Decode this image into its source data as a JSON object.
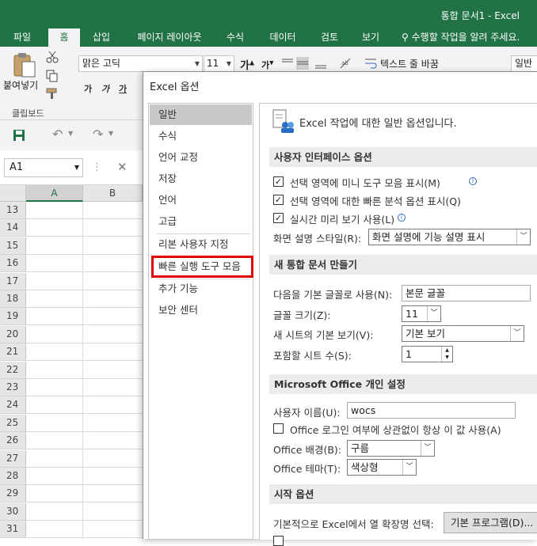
{
  "window": {
    "title": "통합 문서1 - Excel"
  },
  "ribbon": {
    "tabs": [
      "파일",
      "홈",
      "삽입",
      "페이지 레이아웃",
      "수식",
      "데이터",
      "검토",
      "보기"
    ],
    "active_tab": "홈",
    "tell_me": "수행할 작업을 알려 주세요.",
    "paste_label": "붙여넣기",
    "clipboard_group": "클립보드",
    "font_name": "맑은 고딕",
    "font_size": "11",
    "bold": "가",
    "italic": "가",
    "underline": "가",
    "wrap_text": "텍스트 줄 바꿈",
    "number_format": "일반"
  },
  "formula_bar": {
    "name_box": "A1",
    "dots": "⋮",
    "cancel": "✕"
  },
  "sheet": {
    "columns": [
      "A",
      "B"
    ],
    "rows": [
      "13",
      "14",
      "15",
      "16",
      "17",
      "18",
      "19",
      "20",
      "21",
      "22",
      "23",
      "24",
      "25",
      "26",
      "27",
      "28",
      "29",
      "30",
      "31"
    ]
  },
  "dialog": {
    "title": "Excel 옵션",
    "nav": [
      "일반",
      "수식",
      "언어 교정",
      "저장",
      "언어",
      "고급",
      "리본 사용자 지정",
      "빠른 실행 도구 모음",
      "추가 기능",
      "보안 센터"
    ],
    "active_nav": "일반",
    "highlighted_nav": "빠른 실행 도구 모음",
    "intro": "Excel 작업에 대한 일반 옵션입니다.",
    "ui_section": {
      "header": "사용자 인터페이스 옵션",
      "mini_toolbar": "선택 영역에 미니 도구 모음 표시(M)",
      "quick_analysis": "선택 영역에 대한 빠른 분석 옵션 표시(Q)",
      "live_preview": "실시간 미리 보기 사용(L)",
      "screentip_label": "화면 설명 스타일(R):",
      "screentip_value": "화면 설명에 기능 설명 표시"
    },
    "new_wb_section": {
      "header": "새 통합 문서 만들기",
      "font_label": "다음을 기본 글꼴로 사용(N):",
      "font_value": "본문 글꼴",
      "size_label": "글꼴 크기(Z):",
      "size_value": "11",
      "view_label": "새 시트의 기본 보기(V):",
      "view_value": "기본 보기",
      "sheets_label": "포함할 시트 수(S):",
      "sheets_value": "1"
    },
    "personal_section": {
      "header": "Microsoft Office 개인 설정",
      "username_label": "사용자 이름(U):",
      "username_value": "wocs",
      "always_use": "Office 로그인 여부에 상관없이 항상 이 값 사용(A)",
      "background_label": "Office 배경(B):",
      "background_value": "구름",
      "theme_label": "Office 테마(T):",
      "theme_value": "색상형"
    },
    "startup_section": {
      "header": "시작 옵션",
      "ext_label": "기본적으로 Excel에서 열 확장명 선택:",
      "default_programs": "기본 프로그램(D)..."
    }
  },
  "colors": {
    "excel_green": "#217346",
    "highlight_red": "#e00000"
  }
}
